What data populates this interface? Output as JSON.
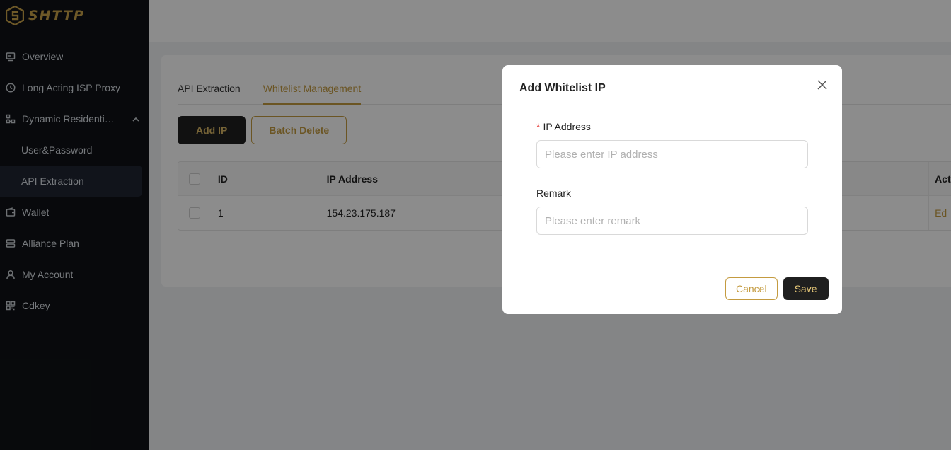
{
  "brand": {
    "name": "SHTTP",
    "accent_color": "#c49b40"
  },
  "sidebar": {
    "items": [
      {
        "label": "Overview",
        "icon": "dashboard-icon"
      },
      {
        "label": "Long Acting ISP Proxy",
        "icon": "clock-icon"
      },
      {
        "label": "Dynamic Residential Proxy",
        "icon": "network-icon"
      },
      {
        "label": "User&Password"
      },
      {
        "label": "API Extraction"
      },
      {
        "label": "Wallet",
        "icon": "wallet-icon"
      },
      {
        "label": "Alliance Plan",
        "icon": "layers-icon"
      },
      {
        "label": "My Account",
        "icon": "user-icon"
      },
      {
        "label": "Cdkey",
        "icon": "grid-icon"
      }
    ]
  },
  "main": {
    "tabs": [
      {
        "label": "API Extraction"
      },
      {
        "label": "Whitelist Management"
      }
    ],
    "buttons": {
      "add_ip": "Add IP",
      "batch_delete": "Batch Delete"
    },
    "table": {
      "columns": [
        "ID",
        "IP Address",
        "Act"
      ],
      "rows": [
        {
          "id": "1",
          "ip": "154.23.175.187",
          "action": "Ed"
        }
      ]
    }
  },
  "modal": {
    "title": "Add Whitelist IP",
    "fields": {
      "ip": {
        "label": "IP Address",
        "required_mark": "*",
        "placeholder": "Please enter IP address",
        "value": ""
      },
      "remark": {
        "label": "Remark",
        "placeholder": "Please enter remark",
        "value": ""
      }
    },
    "buttons": {
      "cancel": "Cancel",
      "save": "Save"
    }
  }
}
